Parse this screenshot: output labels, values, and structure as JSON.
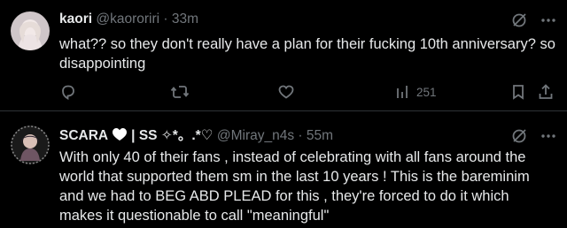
{
  "tweets": [
    {
      "name": "kaori",
      "handle": "@kaororiri",
      "separator": "·",
      "time": "33m",
      "text": "what?? so they don't really have a plan for their fucking 10th anniversary? so disappointing",
      "views": "251",
      "icons": [
        "grok-icon",
        "more-icon",
        "reply-icon",
        "repost-icon",
        "like-icon",
        "views-icon",
        "bookmark-icon",
        "share-icon"
      ]
    },
    {
      "name_prefix": "SCARA",
      "name_suffix": "| SS ✧*。.*♡",
      "handle": "@Miray_n4s",
      "separator": "·",
      "time": "55m",
      "text": "With only 40 of their fans , instead of celebrating with all fans around the world that supported them sm in the last 10 years ! This is the bareminim and we had to BEG ABD PLEAD for this , they're forced to do it which makes it questionable to call \"meaningful\"",
      "icons": [
        "heart-emoji-icon",
        "grok-icon",
        "more-icon"
      ]
    }
  ],
  "colors": {
    "background": "#000000",
    "text": "#e7e9ea",
    "secondary": "#71767b",
    "divider": "#2f3336"
  }
}
